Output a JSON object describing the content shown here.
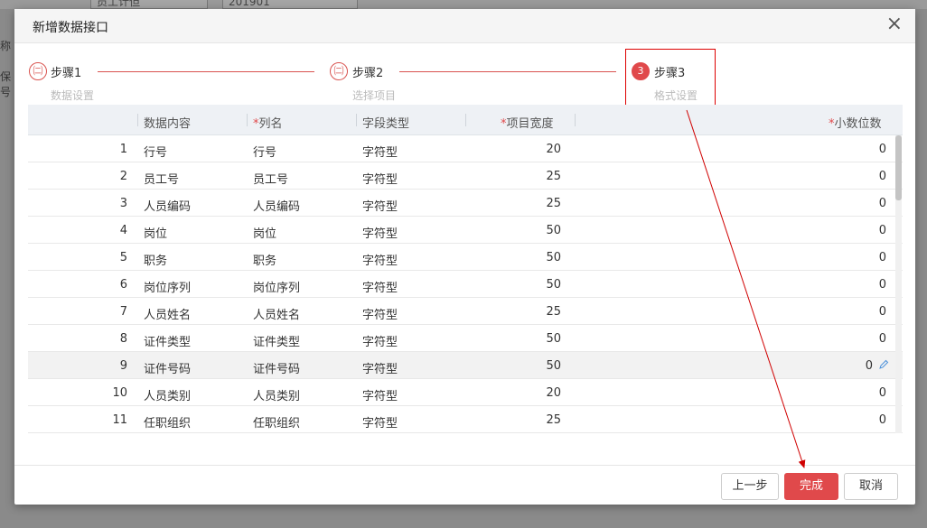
{
  "background": {
    "field1": "员工计但",
    "field2": "201901",
    "side1": "称",
    "side2": "保号"
  },
  "modal": {
    "title": "新增数据接口",
    "close_glyph": "×"
  },
  "steps": [
    {
      "badge": "㈡",
      "title": "步骤1",
      "sub": "数据设置",
      "state": "done"
    },
    {
      "badge": "㈡",
      "title": "步骤2",
      "sub": "选择项目",
      "state": "done"
    },
    {
      "badge": "3",
      "title": "步骤3",
      "sub": "格式设置",
      "state": "active"
    }
  ],
  "table": {
    "headers": [
      {
        "label": "数据内容",
        "required": false
      },
      {
        "label": "列名",
        "required": true
      },
      {
        "label": "字段类型",
        "required": false
      },
      {
        "label": "项目宽度",
        "required": true
      },
      {
        "label": "小数位数",
        "required": true
      }
    ],
    "required_mark": "*",
    "rows": [
      {
        "index": "1",
        "content": "行号",
        "column": "行号",
        "type": "字符型",
        "width": "20",
        "decimals": "0"
      },
      {
        "index": "2",
        "content": "员工号",
        "column": "员工号",
        "type": "字符型",
        "width": "25",
        "decimals": "0"
      },
      {
        "index": "3",
        "content": "人员编码",
        "column": "人员编码",
        "type": "字符型",
        "width": "25",
        "decimals": "0"
      },
      {
        "index": "4",
        "content": "岗位",
        "column": "岗位",
        "type": "字符型",
        "width": "50",
        "decimals": "0"
      },
      {
        "index": "5",
        "content": "职务",
        "column": "职务",
        "type": "字符型",
        "width": "50",
        "decimals": "0"
      },
      {
        "index": "6",
        "content": "岗位序列",
        "column": "岗位序列",
        "type": "字符型",
        "width": "50",
        "decimals": "0"
      },
      {
        "index": "7",
        "content": "人员姓名",
        "column": "人员姓名",
        "type": "字符型",
        "width": "25",
        "decimals": "0"
      },
      {
        "index": "8",
        "content": "证件类型",
        "column": "证件类型",
        "type": "字符型",
        "width": "50",
        "decimals": "0"
      },
      {
        "index": "9",
        "content": "证件号码",
        "column": "证件号码",
        "type": "字符型",
        "width": "50",
        "decimals": "0"
      },
      {
        "index": "10",
        "content": "人员类别",
        "column": "人员类别",
        "type": "字符型",
        "width": "20",
        "decimals": "0"
      },
      {
        "index": "11",
        "content": "任职组织",
        "column": "任职组织",
        "type": "字符型",
        "width": "25",
        "decimals": "0"
      }
    ],
    "highlighted_row": 8
  },
  "footer": {
    "prev_label": "上一步",
    "finish_label": "完成",
    "cancel_label": "取消"
  },
  "colors": {
    "accent": "#e0494b",
    "annotation": "#d00000"
  }
}
